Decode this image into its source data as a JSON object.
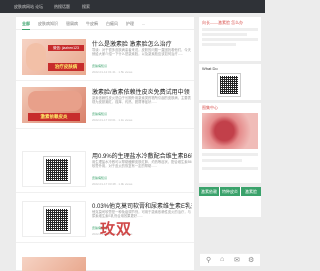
{
  "topbar": {
    "site": "皮肤病网站 论坛",
    "nav1": "热搜话题",
    "nav2": "搜索"
  },
  "tabs": [
    "全部",
    "皮肤病知识",
    "银屑病",
    "牛皮癣",
    "白癜风",
    "护理",
    "..."
  ],
  "posts": [
    {
      "thumb_caption": "微信: jiazhen123",
      "thumb_banner": "治疗皮肤病",
      "title": "什么是激素脸 激素脸怎么治疗",
      "excerpt": "导读：对于很多皮肤病患者来说，皮肤的问题一直困扰着他们，今天就给大家介绍一下什么是激素脸，以及激素脸应该如何治疗......",
      "tag": "皮肤病知识",
      "meta": "2022-01-12 01:41  ·  1.5k views"
    },
    {
      "thumb_banner": "激素依赖皮炎",
      "title": "激素脸/激素依赖性皮炎免费试用中领",
      "excerpt": "激素依赖性皮炎是由于长期外用激素类药物所引起的皮肤病，主要表现为皮肤潮红、瘙痒、灼热、脱屑等症状......",
      "tag": "皮肤病知识",
      "meta": "2022-01-17 03:01  ·  1.1k views"
    },
    {
      "title": "用0.9%的生理盐水冷敷配合维生素B6软膏",
      "excerpt": "用生理盐水冷敷可以帮助缓解皮肤红肿、灼热等症状，配合维生素B6软膏外用，对于皮炎的恢复有一定的帮助......",
      "tag": "皮肤病知识",
      "meta": "2022-01-17 03:48  ·  1.9k views"
    },
    {
      "title": "0.03%他克莫司软膏和尿素维生素E乳剂结合",
      "excerpt": "他克莫司软膏是一种免疫调节剂，可用于激素依赖性皮炎的治疗，与尿素维生素E乳剂合用效果更好......",
      "tag": "皮肤病知识",
      "meta": "2022-01-17 03:48  ·  1.2k views"
    },
    {
      "title": "",
      "excerpt": "",
      "tag": "",
      "meta": ""
    }
  ],
  "side": {
    "title1": "向长——激素脸 怎么办",
    "who_title": "What Do",
    "images_title": "图集中心",
    "tags_title": "标签",
    "tags": [
      "激素依赖",
      "特种皮炎",
      "激素脸"
    ]
  },
  "watermark": "玫双",
  "colors": {
    "accent": "#3aa26b",
    "topbar": "#2f3237",
    "red": "#d9534f"
  }
}
